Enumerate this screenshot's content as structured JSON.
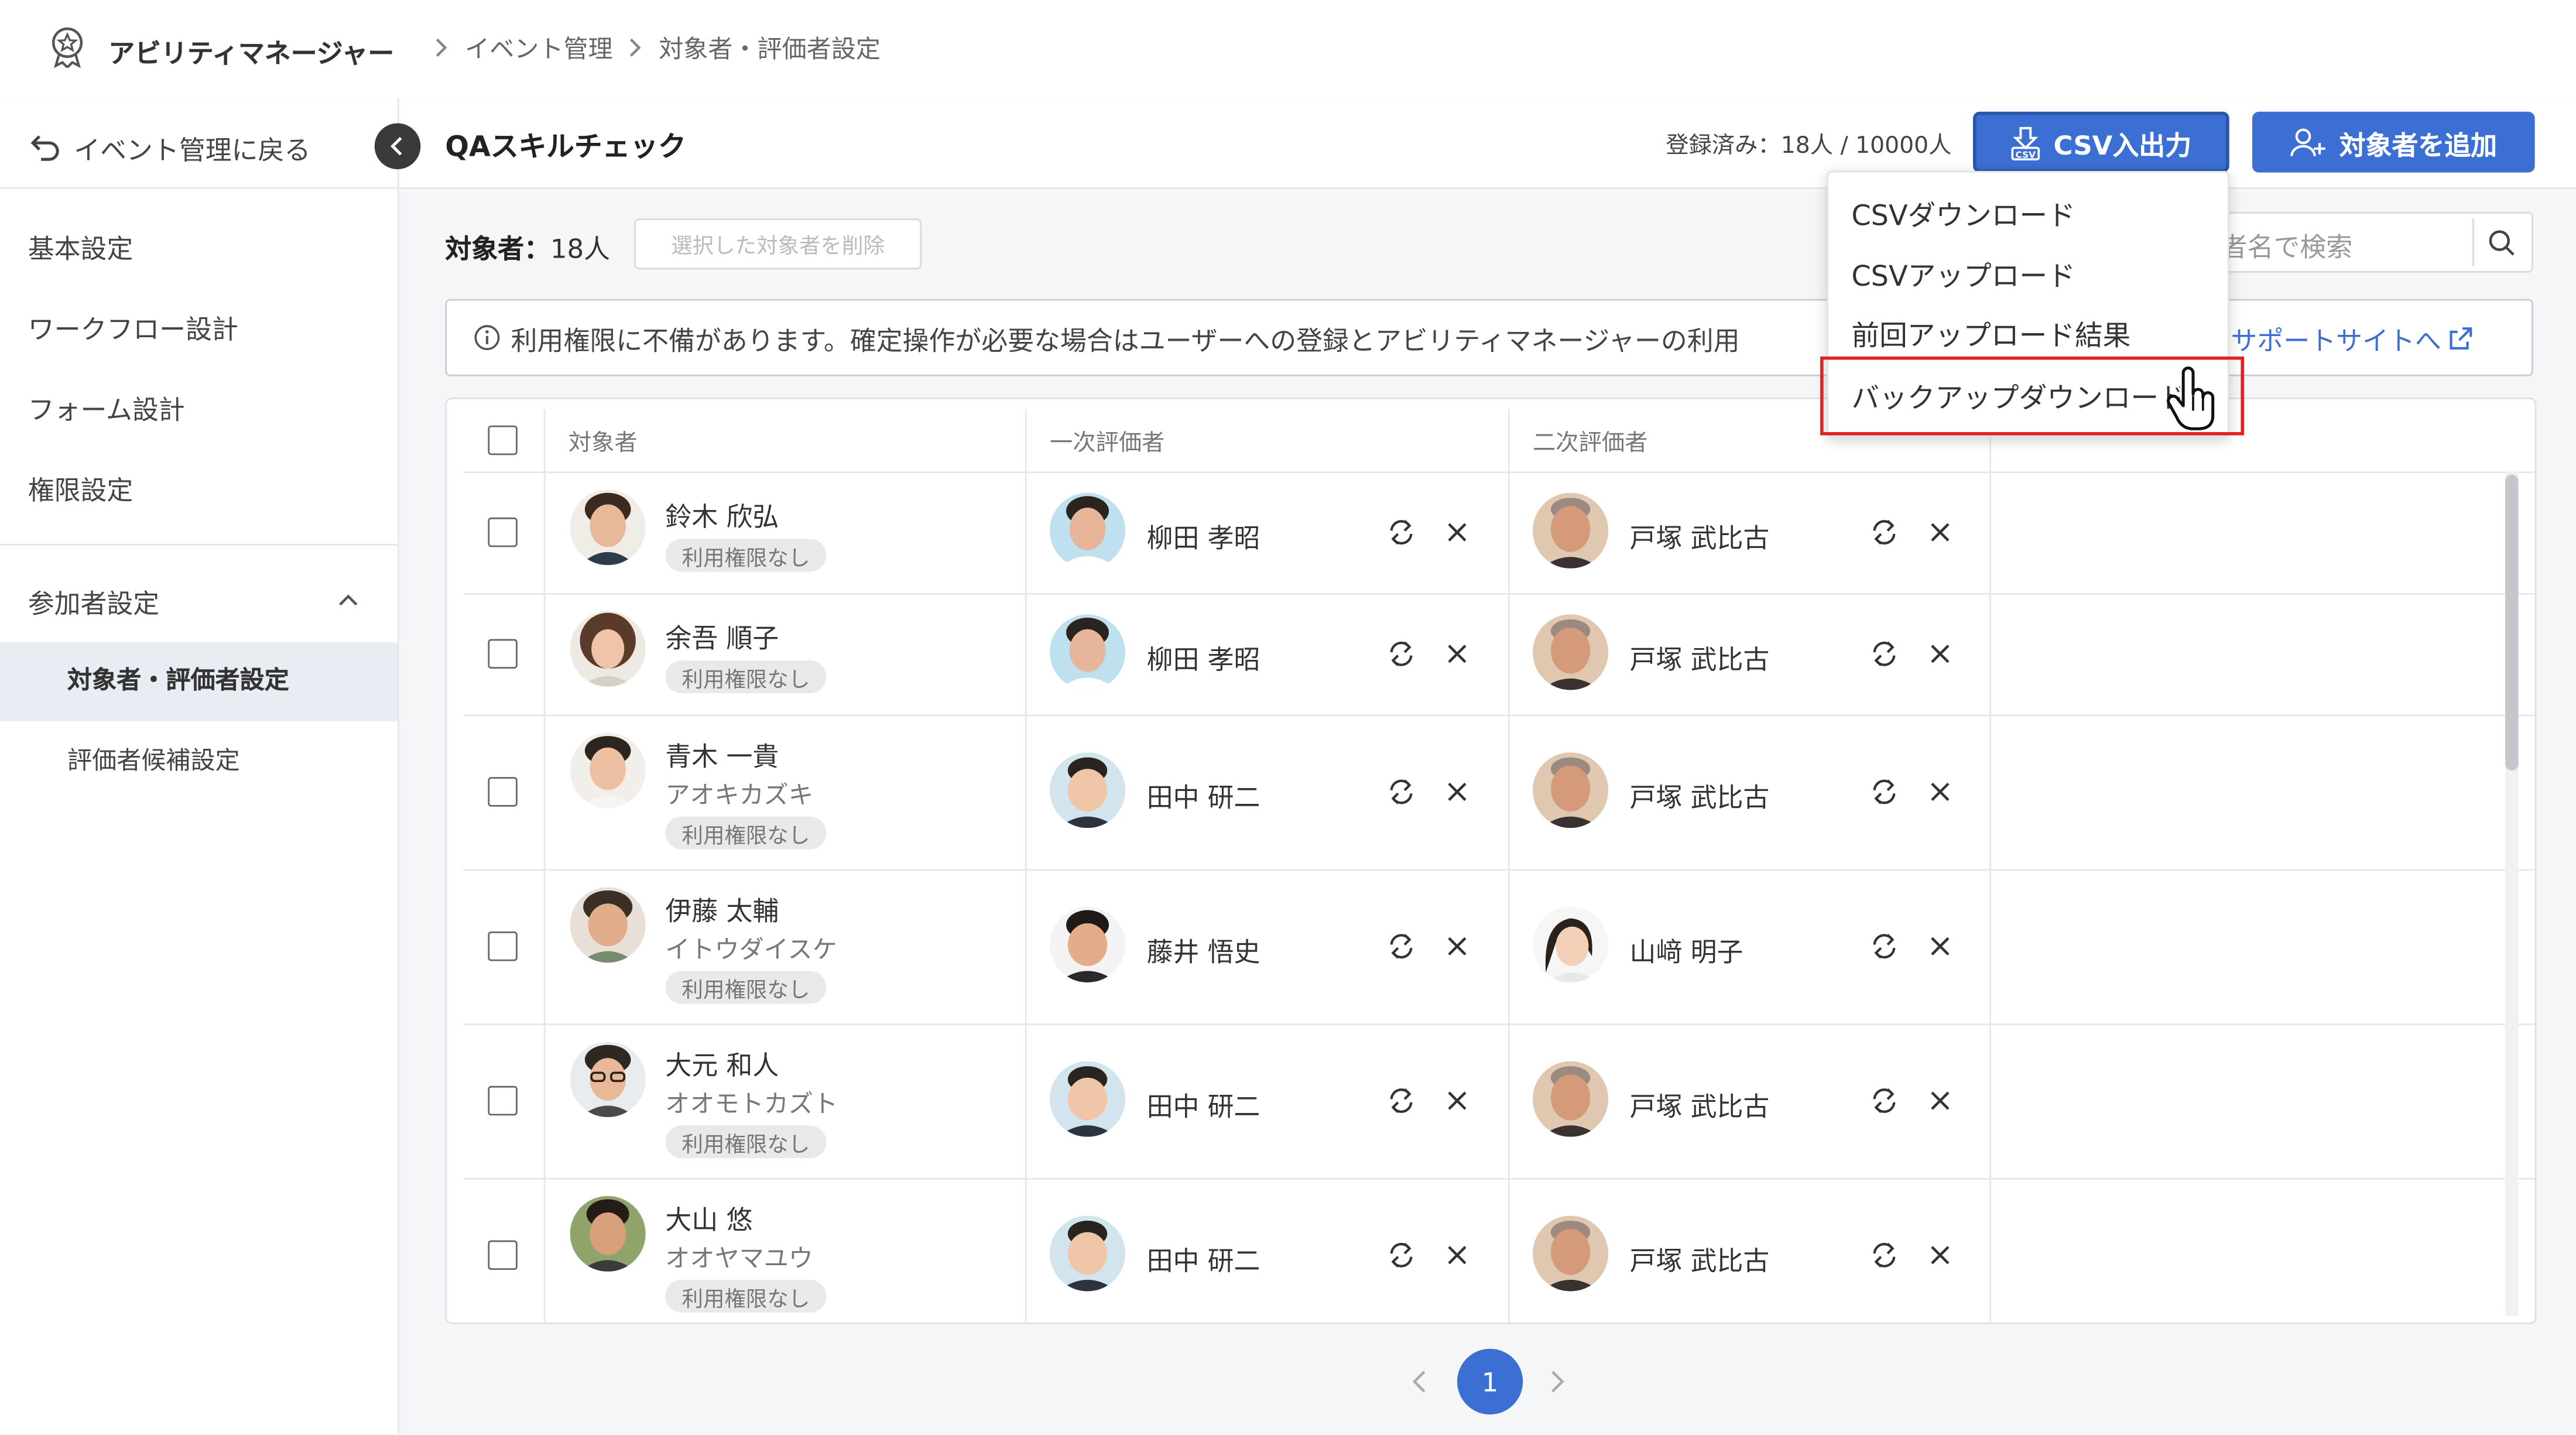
{
  "breadcrumb": {
    "app": "アビリティマネージャー",
    "level1": "イベント管理",
    "level2": "対象者・評価者設定"
  },
  "sidebar": {
    "back_label": "イベント管理に戻る",
    "items": [
      {
        "label": "基本設定"
      },
      {
        "label": "ワークフロー設計"
      },
      {
        "label": "フォーム設計"
      },
      {
        "label": "権限設定"
      }
    ],
    "group": {
      "label": "参加者設定",
      "expanded": true,
      "items": [
        {
          "label": "対象者・評価者設定",
          "active": true
        },
        {
          "label": "評価者候補設定",
          "active": false
        }
      ]
    }
  },
  "event": {
    "title": "QAスキルチェック",
    "registered": "登録済み：18人 / 10000人"
  },
  "buttons": {
    "csv": "CSV入出力",
    "add_target": "対象者を追加",
    "delete_selected": "選択した対象者を削除"
  },
  "csv_menu": {
    "items": [
      {
        "label": "CSVダウンロード"
      },
      {
        "label": "CSVアップロード"
      },
      {
        "label": "前回アップロード結果"
      },
      {
        "label": "バックアップダウンロード",
        "highlighted": true
      }
    ]
  },
  "targets": {
    "label": "対象者：",
    "count": "18人"
  },
  "search": {
    "placeholder": "者名で検索"
  },
  "notice": {
    "text": "利用権限に不備があります。確定操作が必要な場合はユーザーへの登録とアビリティマネージャーの利用",
    "link": "サポートサイトへ"
  },
  "table": {
    "headers": {
      "target": "対象者",
      "first": "一次評価者",
      "second": "二次評価者"
    },
    "rows": [
      {
        "name": "鈴木 欣弘",
        "kana": "",
        "badge": "利用権限なし",
        "first": "柳田 孝昭",
        "second": "戸塚 武比古"
      },
      {
        "name": "余吾 順子",
        "kana": "",
        "badge": "利用権限なし",
        "first": "柳田 孝昭",
        "second": "戸塚 武比古"
      },
      {
        "name": "青木 一貴",
        "kana": "アオキカズキ",
        "badge": "利用権限なし",
        "first": "田中 研二",
        "second": "戸塚 武比古"
      },
      {
        "name": "伊藤 太輔",
        "kana": "イトウダイスケ",
        "badge": "利用権限なし",
        "first": "藤井 悟史",
        "second": "山﨑 明子"
      },
      {
        "name": "大元 和人",
        "kana": "オオモトカズト",
        "badge": "利用権限なし",
        "first": "田中 研二",
        "second": "戸塚 武比古"
      },
      {
        "name": "大山 悠",
        "kana": "オオヤマユウ",
        "badge": "利用権限なし",
        "first": "田中 研二",
        "second": "戸塚 武比古"
      }
    ]
  },
  "pagination": {
    "current": "1"
  },
  "colors": {
    "primary": "#3b6fd4",
    "highlight_border": "#e02424",
    "active_bg": "#e8ecf3"
  },
  "icons": [
    "award-icon",
    "back-arrow-icon",
    "collapse-icon",
    "csv-icon",
    "add-user-icon",
    "search-icon",
    "info-icon",
    "external-link-icon",
    "swap-icon",
    "close-icon",
    "chevron-up-icon",
    "pointer-cursor-icon"
  ]
}
